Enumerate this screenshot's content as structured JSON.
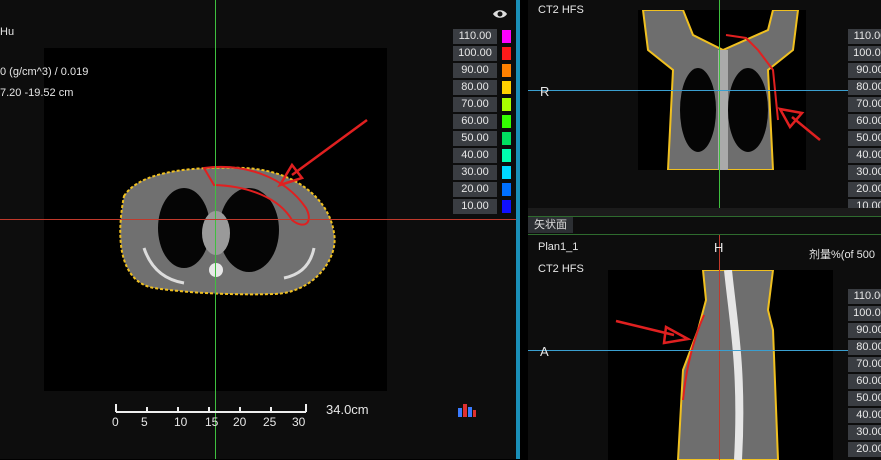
{
  "axial": {
    "hu_label": "Hu",
    "density_label": "0 (g/cm^3) / 0.019",
    "coord_label": "7.20 -19.52 cm",
    "scale": {
      "ticks": [
        "0",
        "5",
        "10",
        "15",
        "20",
        "25",
        "30"
      ],
      "length_label": "34.0cm"
    }
  },
  "coronal": {
    "title": "CT2 HFS",
    "orientation_label": "R"
  },
  "sagittal": {
    "tab_label": "矢状面",
    "plan_label": "Plan1_1",
    "title": "CT2 HFS",
    "orientation_top": "H",
    "orientation_left": "A",
    "dose_label": "剂量%(of 500"
  },
  "isodose_legend": [
    {
      "value": "110.00",
      "color": "#ff00ff"
    },
    {
      "value": "100.00",
      "color": "#ff1a1a"
    },
    {
      "value": "90.00",
      "color": "#ff8000"
    },
    {
      "value": "80.00",
      "color": "#ffd000"
    },
    {
      "value": "70.00",
      "color": "#aaff00"
    },
    {
      "value": "60.00",
      "color": "#33ff00"
    },
    {
      "value": "50.00",
      "color": "#00e060"
    },
    {
      "value": "40.00",
      "color": "#00ffb0"
    },
    {
      "value": "30.00",
      "color": "#00d8ff"
    },
    {
      "value": "20.00",
      "color": "#0070ff"
    },
    {
      "value": "10.00",
      "color": "#1010ff"
    }
  ],
  "icons": {
    "visibility": "eye-icon",
    "tool": "color-bars-icon"
  },
  "colors": {
    "crosshair_green": "#3fbf3f",
    "crosshair_red": "#c0392b",
    "crosshair_blue": "#3a9fd0",
    "body_contour": "#f0c020",
    "target_contour": "#e02020",
    "arrow": "#e02020",
    "separator": "#1a8fb8"
  }
}
